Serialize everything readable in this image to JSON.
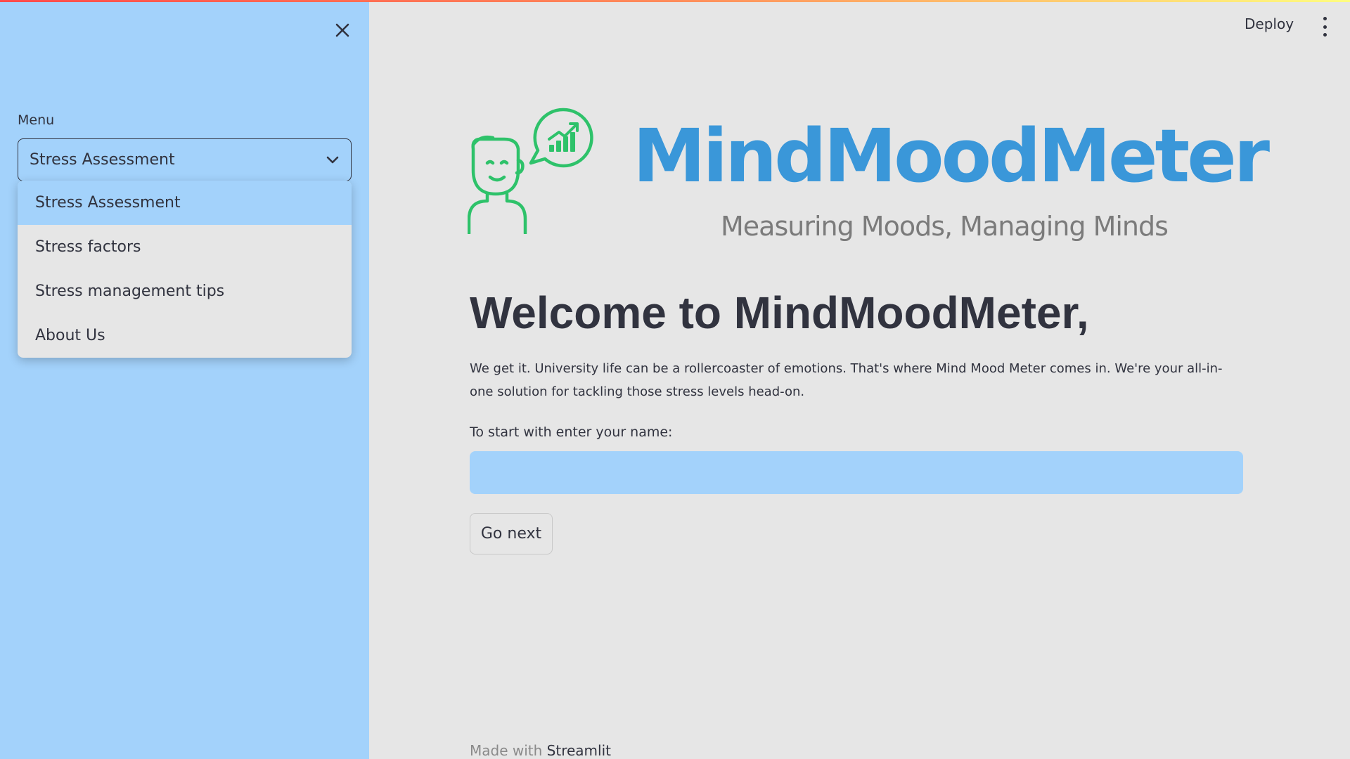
{
  "sidebar": {
    "menu_label": "Menu",
    "select_value": "Stress Assessment",
    "options": [
      {
        "label": "Stress Assessment",
        "selected": true
      },
      {
        "label": "Stress factors",
        "selected": false
      },
      {
        "label": "Stress management tips",
        "selected": false
      },
      {
        "label": "About Us",
        "selected": false
      }
    ]
  },
  "header": {
    "deploy_label": "Deploy"
  },
  "logo": {
    "title": "MindMoodMeter",
    "tagline": "Measuring Moods, Managing Minds"
  },
  "main": {
    "heading": "Welcome to MindMoodMeter,",
    "paragraph": "We get it. University life can be a rollercoaster of emotions. That's where Mind Mood Meter comes in. We're your all-in-one solution for tackling those stress levels head-on.",
    "input_label": "To start with enter your name:",
    "input_value": "",
    "button_label": "Go next"
  },
  "footer": {
    "prefix": "Made with",
    "brand": "Streamlit"
  },
  "colors": {
    "sidebar_bg": "#a3d2fb",
    "main_bg": "#e6e6e6",
    "logo_blue": "#3a97d9",
    "logo_green": "#2ec26a",
    "text": "#31333f"
  },
  "icons": {
    "close": "close-icon",
    "chevron": "chevron-down-icon",
    "menu": "kebab-menu-icon",
    "logo": "person-chat-chart-icon"
  }
}
